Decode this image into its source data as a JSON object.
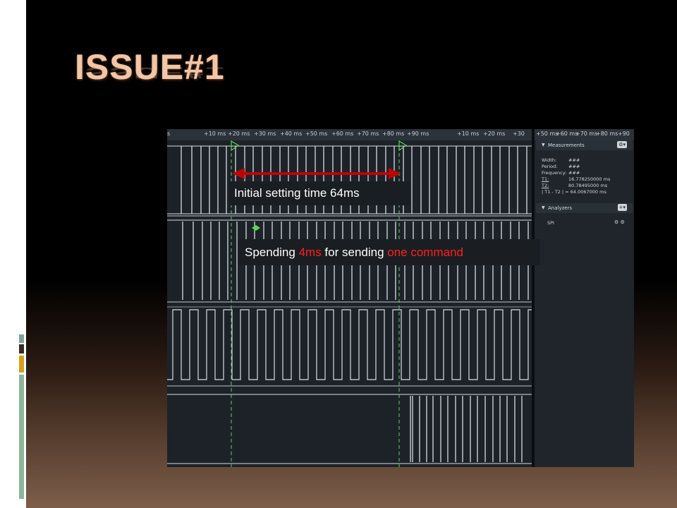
{
  "slide": {
    "title": "ISSUE#1",
    "colors": {
      "title": "#f1c6a8",
      "arrow": "#c00000",
      "highlight": "#ff1f1f",
      "marker": "#5fd35f"
    }
  },
  "ruler": {
    "main_ticks": [
      "s",
      "+10 ms",
      "+20 ms",
      "+30 ms",
      "+40 ms",
      "+50 ms",
      "+60 ms",
      "+70 ms",
      "+80 ms",
      "+90 ms",
      "+10 ms",
      "+20 ms",
      "+30"
    ],
    "side_ticks": [
      "+50 ms",
      "+60 ms",
      "+70 ms",
      "+80 ms",
      "+90"
    ]
  },
  "panel": {
    "measurements": {
      "header": "Measurements",
      "rows": [
        {
          "key": "Width:",
          "value": "###"
        },
        {
          "key": "Period:",
          "value": "###"
        },
        {
          "key": "Frequency:",
          "value": "###"
        },
        {
          "key": "T1:",
          "value": "16.778250000 ms"
        },
        {
          "key": "T2:",
          "value": "80.78495000 ms"
        }
      ],
      "diff": "| T1 - T2 | = 64.0067000 ms"
    },
    "analyzers": {
      "header": "Analyzers",
      "item": "SPI"
    }
  },
  "callouts": {
    "first": "Initial setting time 64ms",
    "second": {
      "p1": "Spending ",
      "p2": "4ms",
      "p3": " for sending ",
      "p4": "one command"
    }
  },
  "icons": [
    "marker-t1-icon",
    "marker-t2-icon",
    "timing-marker-icon",
    "gear-icon",
    "add-analyzer-icon"
  ]
}
